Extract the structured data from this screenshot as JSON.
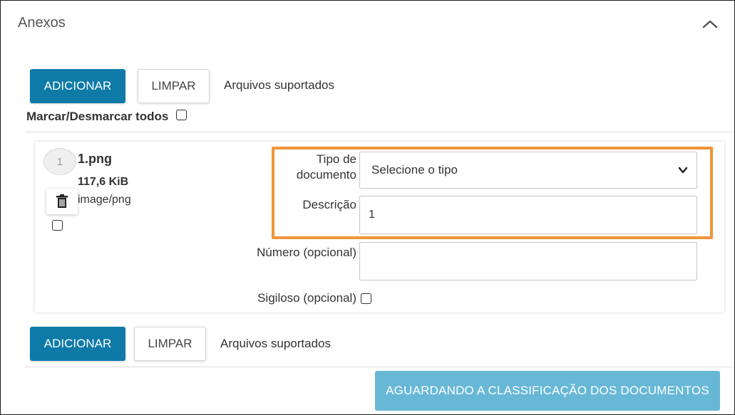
{
  "section": {
    "title": "Anexos"
  },
  "toolbar_top": {
    "add_label": "ADICIONAR",
    "clear_label": "LIMPAR",
    "supported_label": "Arquivos suportados"
  },
  "select_all": {
    "label": "Marcar/Desmarcar todos"
  },
  "file": {
    "index": "1",
    "name": "1.png",
    "size": "117,6 KiB",
    "mime": "image/png"
  },
  "form": {
    "doc_type_label_line1": "Tipo de",
    "doc_type_label_line2": "documento",
    "doc_type_value": "Selecione o tipo",
    "description_label": "Descrição",
    "description_value": "1",
    "number_label": "Número (opcional)",
    "number_value": "",
    "confidential_label": "Sigiloso (opcional)"
  },
  "toolbar_bottom": {
    "add_label": "ADICIONAR",
    "clear_label": "LIMPAR",
    "supported_label": "Arquivos suportados"
  },
  "footer": {
    "status_button_label": "AGUARDANDO A CLASSIFICAÇÃO DOS DOCUMENTOS"
  },
  "colors": {
    "primary": "#0e7aa8",
    "disabled_primary": "#67b8d6",
    "highlight": "#f0943a"
  },
  "icons": {
    "collapse": "chevron-up-icon",
    "delete": "trash-icon",
    "dropdown": "chevron-down-icon"
  }
}
